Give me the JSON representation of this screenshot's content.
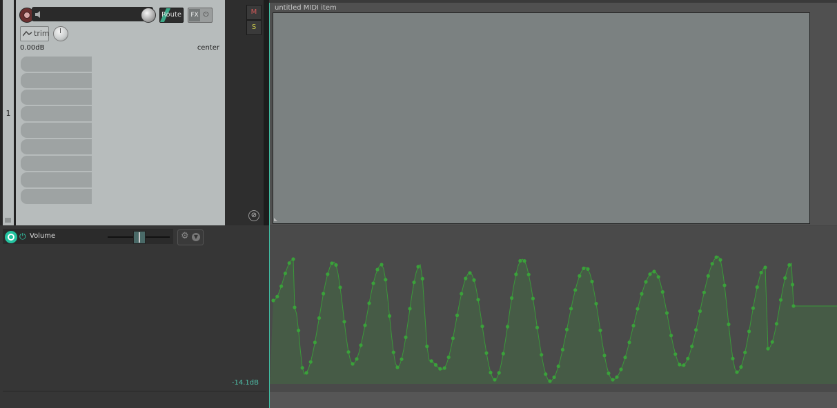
{
  "track": {
    "number": "1",
    "volume_db": "0.00dB",
    "pan": "center",
    "route_label": "Route",
    "fx_label": "FX",
    "trim_label": "trim",
    "mute_label": "M",
    "solo_label": "S",
    "fx_slots": 9
  },
  "envelope": {
    "name": "Volume",
    "value": "-14.1dB",
    "color": "#3a9a3a"
  },
  "item": {
    "name": "untitled MIDI item"
  },
  "colors": {
    "accent": "#3fbfa4",
    "record": "#6a3030",
    "mute": "#d45a5a",
    "solo": "#c8c84a"
  }
}
